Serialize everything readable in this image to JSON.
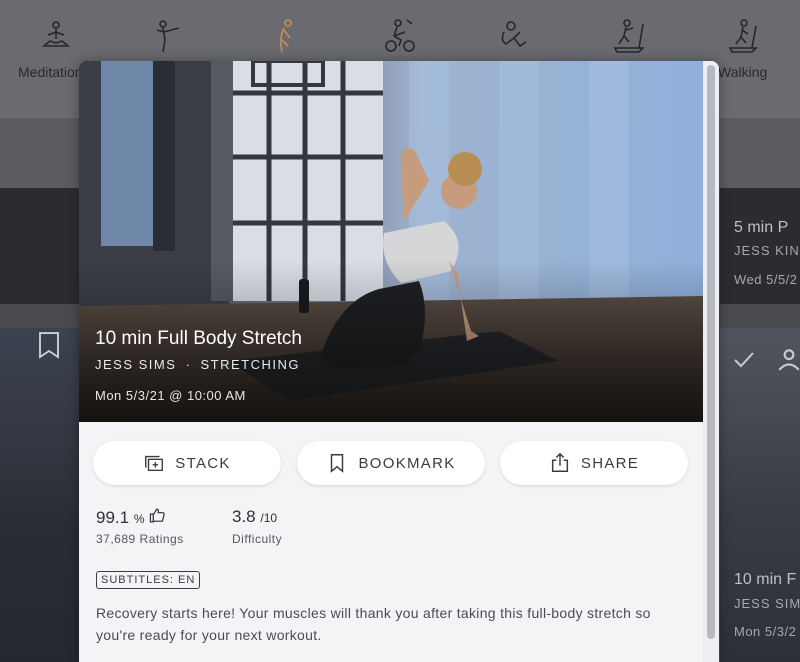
{
  "categories": [
    {
      "label": "Meditation",
      "icon": "meditation-icon"
    },
    {
      "label": "",
      "icon": "strength-icon"
    },
    {
      "label": "",
      "icon": "stretching-icon"
    },
    {
      "label": "",
      "icon": "cycling-icon"
    },
    {
      "label": "",
      "icon": "cardio-icon"
    },
    {
      "label": "",
      "icon": "treadmill-icon"
    },
    {
      "label": "Walking",
      "icon": "walking-icon"
    }
  ],
  "background_cards": {
    "right_top": {
      "title": "5 min P",
      "instructor": "JESS KING",
      "date": "Wed 5/5/2"
    },
    "right_bottom": {
      "title": "10 min F",
      "instructor": "JESS SIMS",
      "date": "Mon 5/3/2"
    }
  },
  "class": {
    "title": "10 min Full Body Stretch",
    "instructor": "JESS SIMS",
    "separator": "·",
    "discipline": "STRETCHING",
    "date": "Mon 5/3/21 @ 10:00 AM"
  },
  "actions": {
    "stack_label": "STACK",
    "bookmark_label": "BOOKMARK",
    "share_label": "SHARE"
  },
  "stats": {
    "rating_value": "99.1",
    "rating_unit": "%",
    "ratings_label": "37,689 Ratings",
    "difficulty_value": "3.8",
    "difficulty_unit": "/10",
    "difficulty_label": "Difficulty"
  },
  "subtitles_badge": "SUBTITLES: EN",
  "description": "Recovery starts here! Your muscles will thank you after taking this full-body stretch so you're ready for your next workout.",
  "colors": {
    "accent_stretch": "#c98a55",
    "modal_bg": "#f3f4f6"
  }
}
